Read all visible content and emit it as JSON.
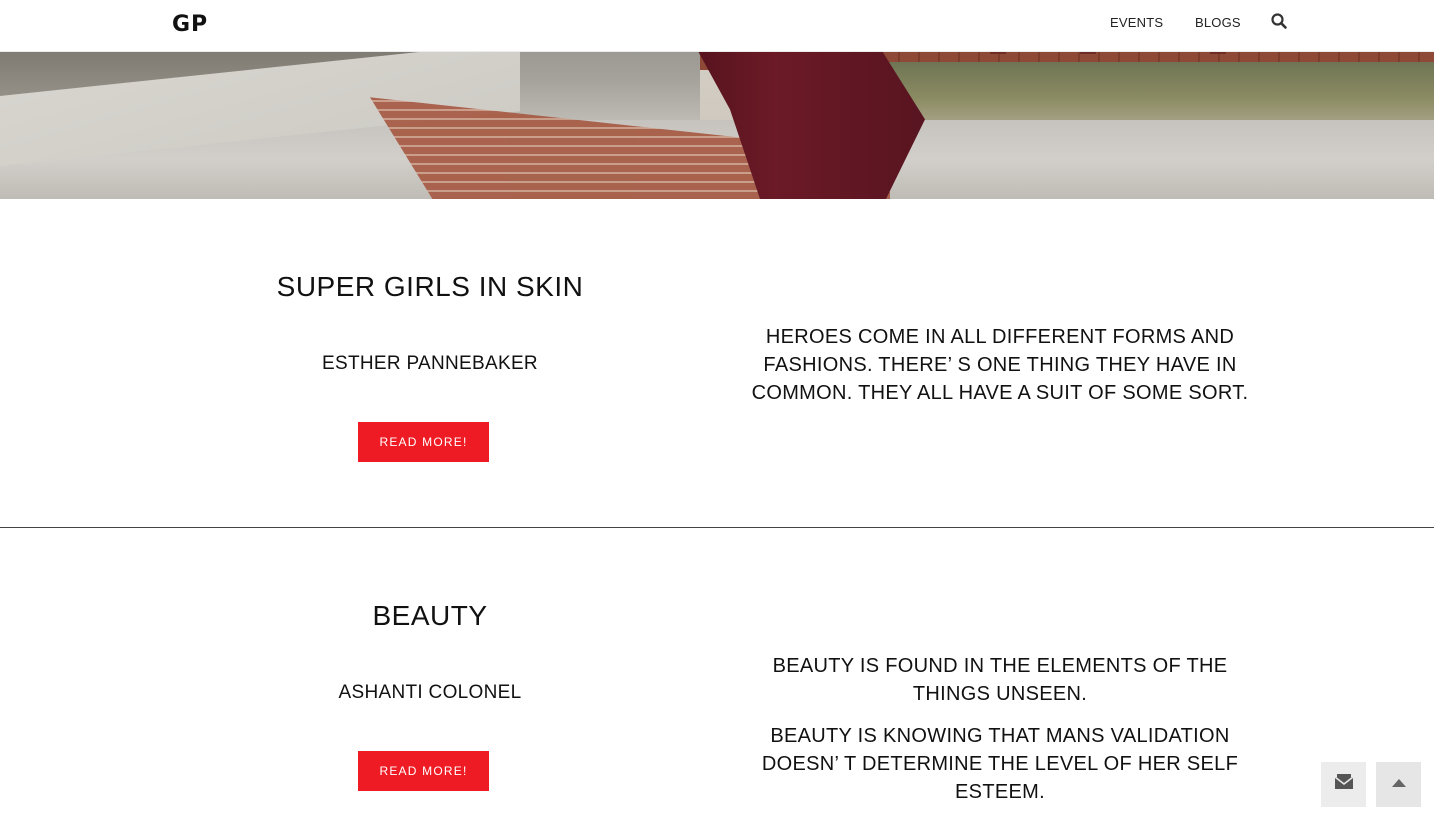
{
  "header": {
    "logo": "GP",
    "nav": [
      {
        "label": "EVENTS"
      },
      {
        "label": "BLOGS"
      }
    ],
    "search_icon": "search-icon"
  },
  "posts": [
    {
      "title": "SUPER GIRLS IN SKIN",
      "author": "ESTHER PANNEBAKER",
      "button": "READ MORE!",
      "quote": [
        "HEROES COME IN ALL DIFFERENT FORMS AND FASHIONS. THERE’ S ONE THING THEY HAVE IN COMMON. THEY ALL HAVE A SUIT OF SOME SORT."
      ]
    },
    {
      "title": "BEAUTY",
      "author": "ASHANTI COLONEL",
      "button": "READ MORE!",
      "quote": [
        "BEAUTY IS FOUND IN THE ELEMENTS OF THE THINGS UNSEEN.",
        "BEAUTY IS KNOWING THAT MANS VALIDATION DOESN’ T DETERMINE THE LEVEL OF HER SELF ESTEEM."
      ]
    }
  ],
  "floating": {
    "contact_icon": "envelope-icon",
    "top_icon": "chevron-up-icon"
  },
  "colors": {
    "accent": "#ee1b24",
    "text": "#111111",
    "float_bg": "#e9e9e9"
  }
}
